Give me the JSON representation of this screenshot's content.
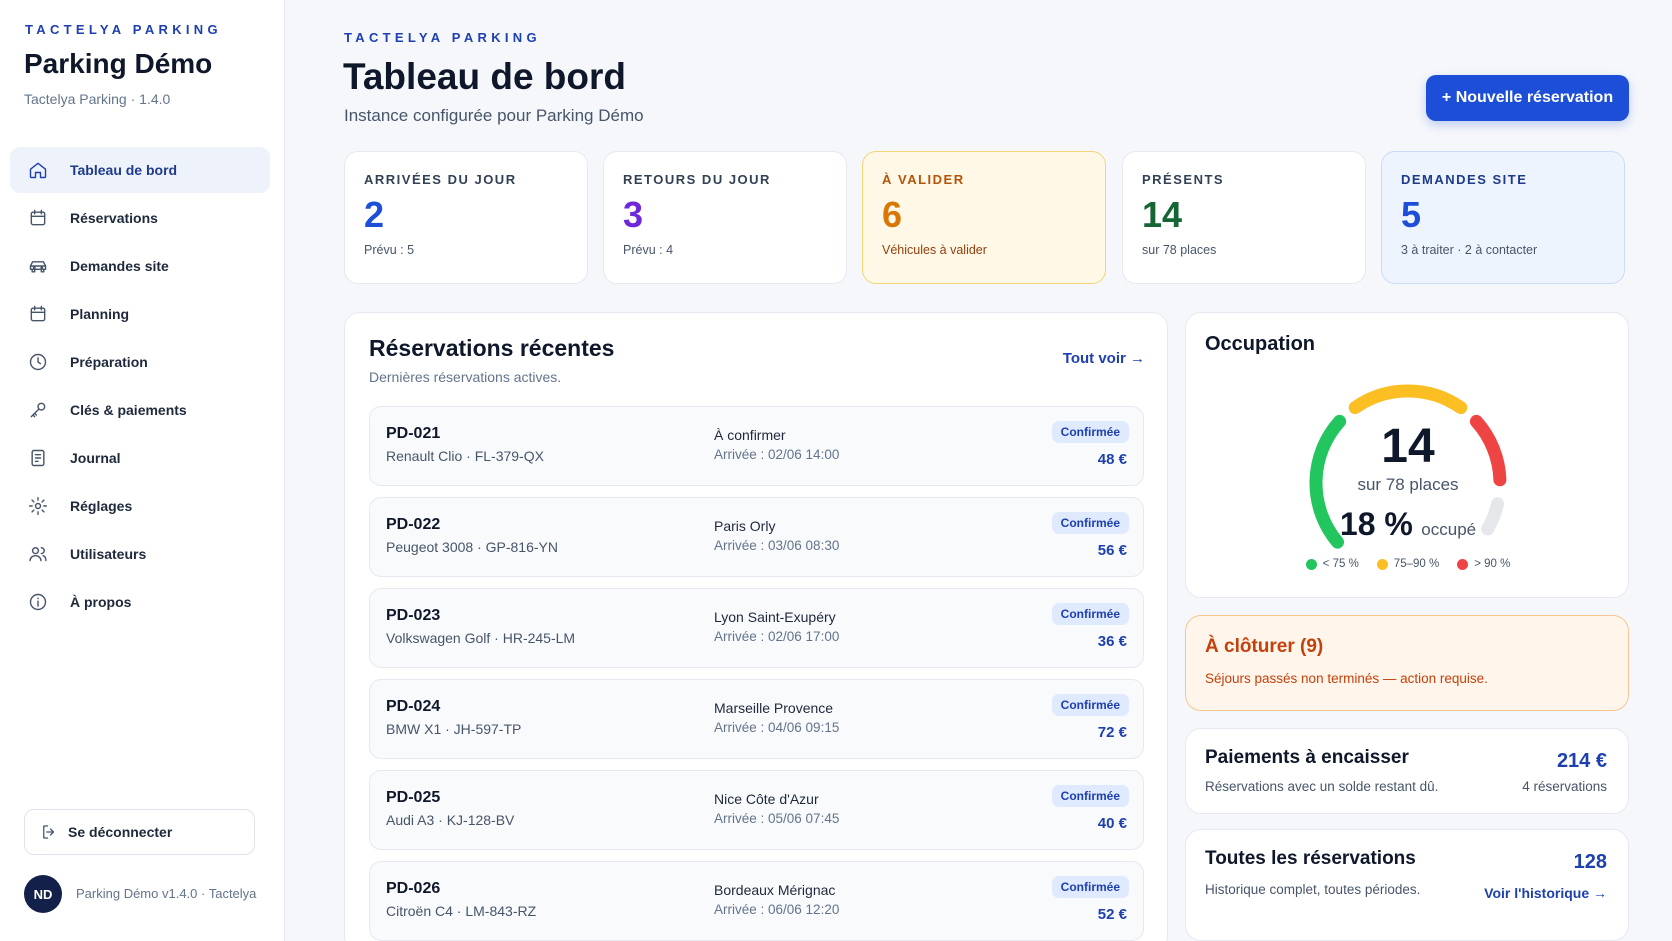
{
  "sidebar": {
    "kicker": "TACTELYA PARKING",
    "title": "Parking Démo",
    "subtitle": "Tactelya Parking · 1.4.0",
    "items": [
      {
        "label": "Tableau de bord",
        "icon": "home-icon"
      },
      {
        "label": "Réservations",
        "icon": "calendar-icon"
      },
      {
        "label": "Demandes site",
        "icon": "car-icon"
      },
      {
        "label": "Planning",
        "icon": "calendar-icon"
      },
      {
        "label": "Préparation",
        "icon": "clock-icon"
      },
      {
        "label": "Clés & paiements",
        "icon": "key-icon"
      },
      {
        "label": "Journal",
        "icon": "journal-icon"
      },
      {
        "label": "Réglages",
        "icon": "gear-icon"
      },
      {
        "label": "Utilisateurs",
        "icon": "users-icon"
      },
      {
        "label": "À propos",
        "icon": "info-icon"
      }
    ],
    "active_index": 0,
    "logout_label": "Se déconnecter",
    "avatar_initials": "ND",
    "version": "Parking Démo v1.4.0 · Tactelya"
  },
  "header": {
    "kicker": "TACTELYA PARKING",
    "title": "Tableau de bord",
    "subtitle": "Instance configurée pour Parking Démo",
    "new_button": "+ Nouvelle réservation"
  },
  "stats": [
    {
      "label": "ARRIVÉES DU JOUR",
      "value": "2",
      "sub": "Prévu : 5",
      "color": "#1d4ed8",
      "style": "default"
    },
    {
      "label": "RETOURS DU JOUR",
      "value": "3",
      "sub": "Prévu : 4",
      "color": "#6d28d9",
      "style": "default"
    },
    {
      "label": "À VALIDER",
      "value": "6",
      "sub": "Véhicules à valider",
      "color": "#d97706",
      "style": "warn"
    },
    {
      "label": "PRÉSENTS",
      "value": "14",
      "sub": "sur 78 places",
      "color": "#166534",
      "style": "default"
    },
    {
      "label": "DEMANDES SITE",
      "value": "5",
      "sub": "3 à traiter · 2 à contacter",
      "color": "#1d4ed8",
      "style": "info"
    }
  ],
  "reservations": {
    "title": "Réservations récentes",
    "subtitle": "Dernières réservations actives.",
    "see_all": "Tout voir →",
    "rows": [
      {
        "id": "PD-021",
        "car": "Renault Clio · FL-379-QX",
        "place": "À confirmer",
        "arrival": "Arrivée : 02/06 14:00",
        "status": "Confirmée",
        "price": "48 €"
      },
      {
        "id": "PD-022",
        "car": "Peugeot 3008 · GP-816-YN",
        "place": "Paris Orly",
        "arrival": "Arrivée : 03/06 08:30",
        "status": "Confirmée",
        "price": "56 €"
      },
      {
        "id": "PD-023",
        "car": "Volkswagen Golf · HR-245-LM",
        "place": "Lyon Saint-Exupéry",
        "arrival": "Arrivée : 02/06 17:00",
        "status": "Confirmée",
        "price": "36 €"
      },
      {
        "id": "PD-024",
        "car": "BMW X1 · JH-597-TP",
        "place": "Marseille Provence",
        "arrival": "Arrivée : 04/06 09:15",
        "status": "Confirmée",
        "price": "72 €"
      },
      {
        "id": "PD-025",
        "car": "Audi A3 · KJ-128-BV",
        "place": "Nice Côte d'Azur",
        "arrival": "Arrivée : 05/06 07:45",
        "status": "Confirmée",
        "price": "40 €"
      },
      {
        "id": "PD-026",
        "car": "Citroën C4 · LM-843-RZ",
        "place": "Bordeaux Mérignac",
        "arrival": "Arrivée : 06/06 12:20",
        "status": "Confirmée",
        "price": "52 €"
      }
    ]
  },
  "occupation": {
    "title": "Occupation",
    "count": "14",
    "capacity_label": "sur 78 places",
    "percent": "18 %",
    "percent_label": "occupé",
    "occupied_fraction": 0.18,
    "legend": [
      {
        "label": "< 75 %",
        "color": "#22c55e"
      },
      {
        "label": "75–90 %",
        "color": "#fbbf24"
      },
      {
        "label": "> 90 %",
        "color": "#ef4444"
      }
    ]
  },
  "to_close": {
    "title": "À clôturer (9)",
    "subtitle": "Séjours passés non terminés — action requise."
  },
  "payments": {
    "title": "Paiements à encaisser",
    "subtitle": "Réservations avec un solde restant dû.",
    "amount": "214 €",
    "count": "4 réservations"
  },
  "all_reservations": {
    "title": "Toutes les réservations",
    "subtitle": "Historique complet, toutes périodes.",
    "count": "128",
    "link": "Voir l'historique →"
  }
}
